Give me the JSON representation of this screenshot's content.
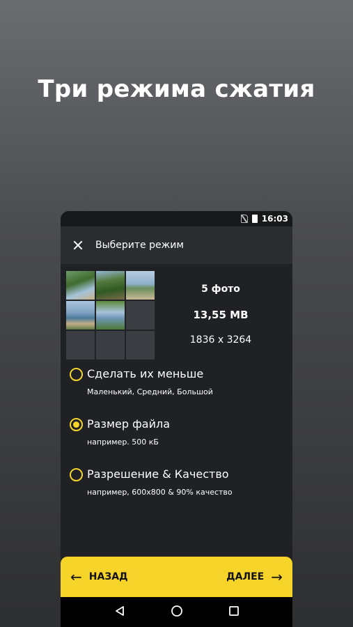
{
  "promo": {
    "headline": "Три режима сжатия"
  },
  "status_bar": {
    "time": "16:03"
  },
  "toolbar": {
    "title": "Выберите режим"
  },
  "summary": {
    "photo_count": "5 фото",
    "total_size": "13,55 MB",
    "resolution": "1836 x 3264"
  },
  "options": [
    {
      "title": "Сделать их меньше",
      "subtitle": "Маленький, Средний, Большой",
      "selected": false
    },
    {
      "title": "Размер файла",
      "subtitle": "например. 500 кБ",
      "selected": true
    },
    {
      "title": "Разрешение & Качество",
      "subtitle": "например, 600x800 & 90% качество",
      "selected": false
    }
  ],
  "bottom_bar": {
    "back_label": "НАЗАД",
    "next_label": "ДАЛЕЕ"
  },
  "colors": {
    "accent": "#f7d42a",
    "panel": "#1f2124",
    "toolbar": "#2a2c30"
  },
  "icons": [
    "close-icon",
    "no-sim-icon",
    "battery-icon",
    "arrow-left-icon",
    "arrow-right-icon",
    "nav-back-icon",
    "nav-home-icon",
    "nav-recent-icon"
  ]
}
